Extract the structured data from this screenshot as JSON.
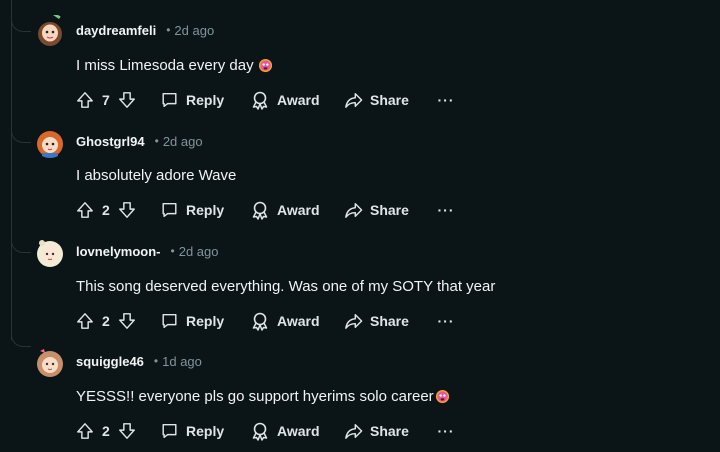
{
  "comments": [
    {
      "author": "daydreamfeli",
      "time": "2d ago",
      "separator": "•",
      "text": "I miss Limesoda every day",
      "emoji": "crying-face",
      "upvotes": "7",
      "reply_label": "Reply",
      "award_label": "Award",
      "share_label": "Share",
      "more_label": "···"
    },
    {
      "author": "Ghostgrl94",
      "time": "2d ago",
      "separator": "•",
      "text": "I absolutely adore Wave",
      "emoji": "",
      "upvotes": "2",
      "reply_label": "Reply",
      "award_label": "Award",
      "share_label": "Share",
      "more_label": "···"
    },
    {
      "author": "lovnelymoon-",
      "time": "2d ago",
      "separator": "•",
      "text": "This song deserved everything. Was one of my SOTY that year",
      "emoji": "",
      "upvotes": "2",
      "reply_label": "Reply",
      "award_label": "Award",
      "share_label": "Share",
      "more_label": "···"
    },
    {
      "author": "squiggle46",
      "time": "1d ago",
      "separator": "•",
      "text": "YESSS!! everyone pls go support hyerims solo career",
      "emoji": "crying-face",
      "upvotes": "2",
      "reply_label": "Reply",
      "award_label": "Award",
      "share_label": "Share",
      "more_label": "···"
    }
  ],
  "colors": {
    "background": "#0b1416",
    "text": "#f2f4f5",
    "muted": "#82959b",
    "thread_line": "#2a3236"
  }
}
